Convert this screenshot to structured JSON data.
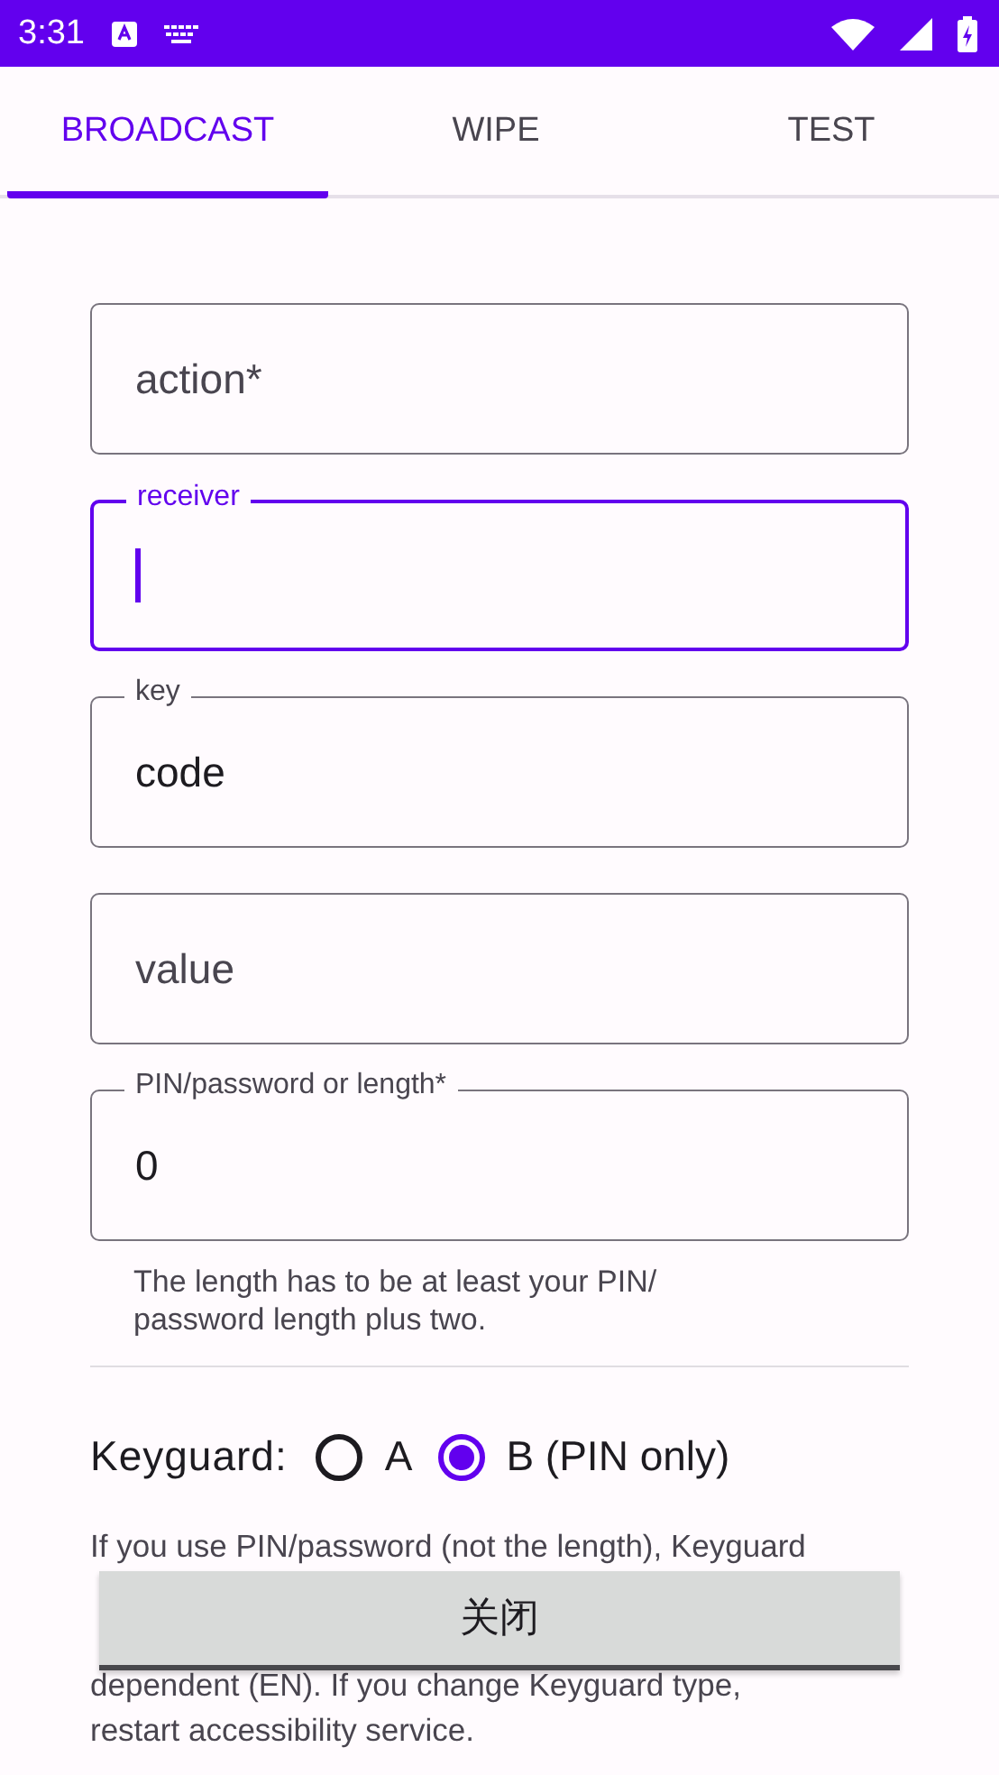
{
  "status_bar": {
    "time": "3:31"
  },
  "tabs": [
    {
      "label": "BROADCAST",
      "selected": true
    },
    {
      "label": "WIPE",
      "selected": false
    },
    {
      "label": "TEST",
      "selected": false
    }
  ],
  "fields": [
    {
      "label": "action*",
      "focused": false
    },
    {
      "label": "receiver",
      "focused": true
    },
    {
      "label": "key",
      "value": "code",
      "focused": false
    },
    {
      "label": "value",
      "focused": false
    },
    {
      "label": "PIN/password or length*",
      "value": "0",
      "focused": false,
      "helper": "The length has to be at least your PIN/ password length plus two."
    }
  ],
  "keyguard": {
    "label": "Keyguard:",
    "options": [
      {
        "label": "A",
        "selected": false
      },
      {
        "label": "B (PIN only)",
        "selected": true
      }
    ]
  },
  "note_lines": [
    "If you use PIN/password (not the length), Keyguard",
    "dependent (EN). If you change Keyguard type,",
    "restart accessibility service."
  ],
  "toast": {
    "label": "关闭"
  }
}
